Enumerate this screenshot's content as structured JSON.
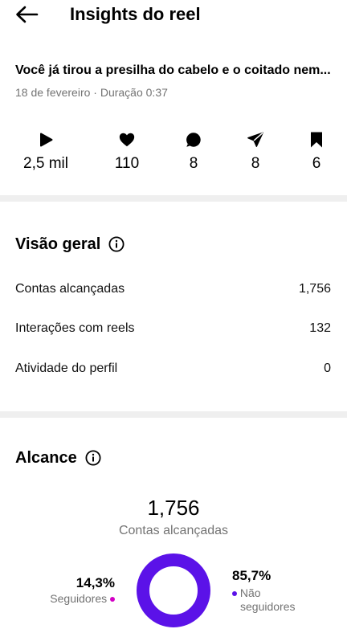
{
  "header": {
    "title": "Insights do reel",
    "back_icon": "arrow-left-icon"
  },
  "reel": {
    "title": "Você já tirou a presilha do cabelo e o coitado nem...",
    "meta": "18 de fevereiro · Duração 0:37"
  },
  "stats": [
    {
      "icon": "play-icon",
      "value": "2,5 mil"
    },
    {
      "icon": "heart-icon",
      "value": "110"
    },
    {
      "icon": "comment-icon",
      "value": "8"
    },
    {
      "icon": "share-icon",
      "value": "8"
    },
    {
      "icon": "bookmark-icon",
      "value": "6"
    }
  ],
  "overview": {
    "title": "Visão geral",
    "rows": [
      {
        "label": "Contas alcançadas",
        "value": "1,756"
      },
      {
        "label": "Interações com reels",
        "value": "132"
      },
      {
        "label": "Atividade do perfil",
        "value": "0"
      }
    ]
  },
  "reach": {
    "title": "Alcance",
    "total": "1,756",
    "total_label": "Contas alcançadas",
    "followers_pct": "14,3%",
    "followers_label": "Seguidores",
    "non_followers_pct": "85,7%",
    "non_followers_label_line1": "Não",
    "non_followers_label_line2": "seguidores",
    "followers_fraction": 0.143,
    "colors": {
      "followers": "#d300c5",
      "non_followers": "#5b12e8"
    }
  }
}
